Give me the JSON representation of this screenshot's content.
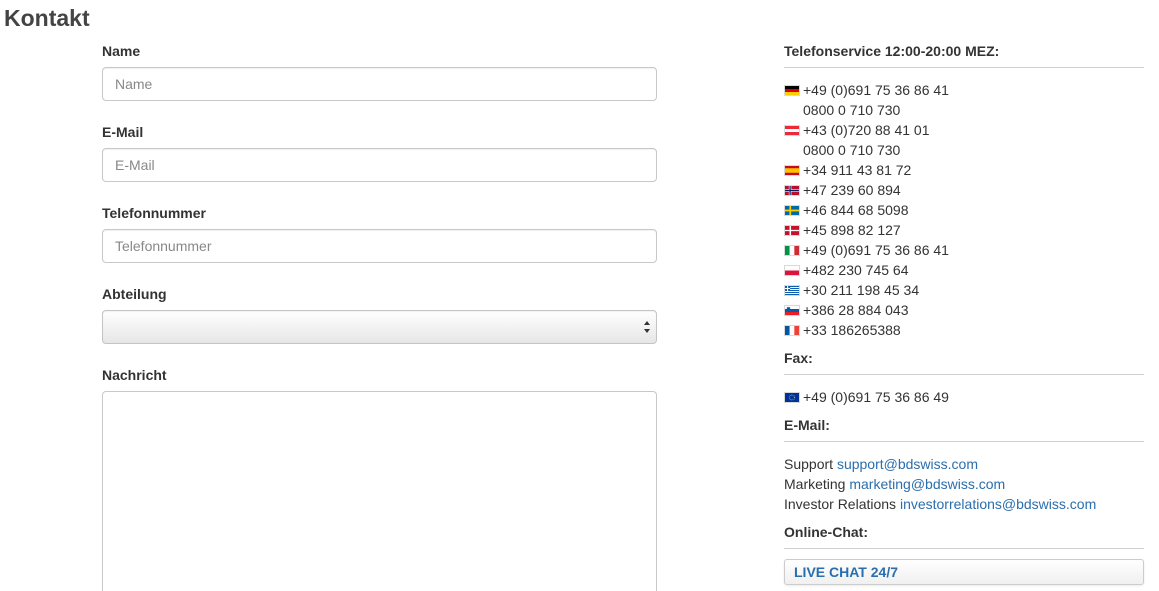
{
  "page": {
    "title": "Kontakt"
  },
  "form": {
    "name": {
      "label": "Name",
      "placeholder": "Name",
      "value": ""
    },
    "email": {
      "label": "E-Mail",
      "placeholder": "E-Mail",
      "value": ""
    },
    "phone": {
      "label": "Telefonnummer",
      "placeholder": "Telefonnummer",
      "value": ""
    },
    "department": {
      "label": "Abteilung",
      "selected": ""
    },
    "message": {
      "label": "Nachricht",
      "value": ""
    }
  },
  "contact": {
    "phone_title": "Telefonservice 12:00-20:00 MEZ:",
    "phones": [
      {
        "flag": "germany-flag",
        "number": "+49 (0)691 75 36 86 41"
      },
      {
        "flag": "",
        "number": "0800 0 710 730"
      },
      {
        "flag": "austria-flag",
        "number": "+43 (0)720 88 41 01"
      },
      {
        "flag": "",
        "number": "0800 0 710 730"
      },
      {
        "flag": "spain-flag",
        "number": "+34 911 43 81 72"
      },
      {
        "flag": "norway-flag",
        "number": "+47 239 60 894"
      },
      {
        "flag": "sweden-flag",
        "number": "+46 844 68 5098"
      },
      {
        "flag": "denmark-flag",
        "number": "+45 898 82 127"
      },
      {
        "flag": "italy-flag",
        "number": "+49 (0)691 75 36 86 41"
      },
      {
        "flag": "poland-flag",
        "number": "+482 230 745 64"
      },
      {
        "flag": "greece-flag",
        "number": "+30 211 198 45 34"
      },
      {
        "flag": "slovenia-flag",
        "number": "+386 28 884 043"
      },
      {
        "flag": "france-flag",
        "number": "+33 186265388"
      }
    ],
    "fax_title": "Fax:",
    "fax": {
      "flag": "eu-flag",
      "number": "+49 (0)691 75 36 86 49"
    },
    "email_title": "E-Mail:",
    "emails": [
      {
        "label": "Support",
        "address": "support@bdswiss.com"
      },
      {
        "label": "Marketing",
        "address": "marketing@bdswiss.com"
      },
      {
        "label": "Investor Relations",
        "address": "investorrelations@bdswiss.com"
      }
    ],
    "chat_title": "Online-Chat:",
    "chat_button": "LIVE CHAT 24/7"
  },
  "colors": {
    "link": "#2a6ead",
    "text": "#333333",
    "border": "#c8c8c8"
  }
}
